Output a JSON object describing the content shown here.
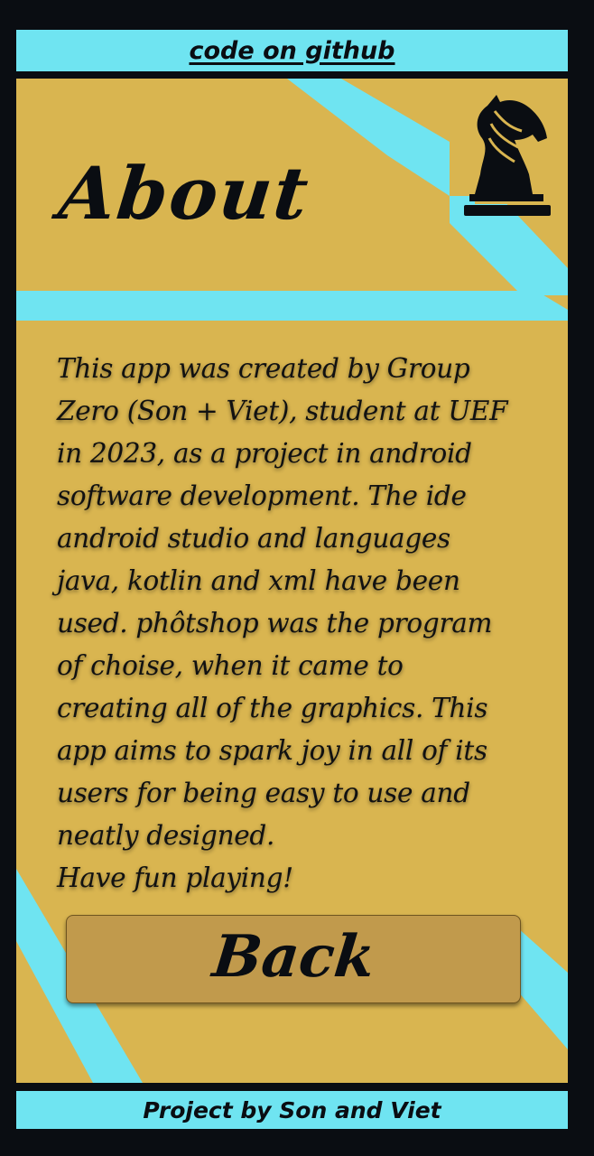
{
  "header": {
    "link_text": "code on github"
  },
  "about": {
    "title": "About",
    "description_lines": [
      "This app was created  by Group",
      "Zero (Son + Viet), student at UEF",
      "in 2023, as a project in android",
      "software development. The ide",
      "android studio and languages",
      "java, kotlin and xml have been",
      "used. phôtshop was the program",
      "of choise, when it came to",
      "creating all of the graphics. This",
      "app aims to spark joy in all of its",
      "users for being easy to use and",
      "neatly designed.",
      "Have fun playing!"
    ]
  },
  "buttons": {
    "back_label": "Back"
  },
  "footer": {
    "credits": "Project by Son and Viet"
  },
  "icons": {
    "logo": "chess-knight-icon"
  },
  "colors": {
    "accent_cyan": "#6fe4f1",
    "panel_gold": "#d9b550",
    "button_gold": "#c19a4c",
    "frame_black": "#0a0d12"
  }
}
